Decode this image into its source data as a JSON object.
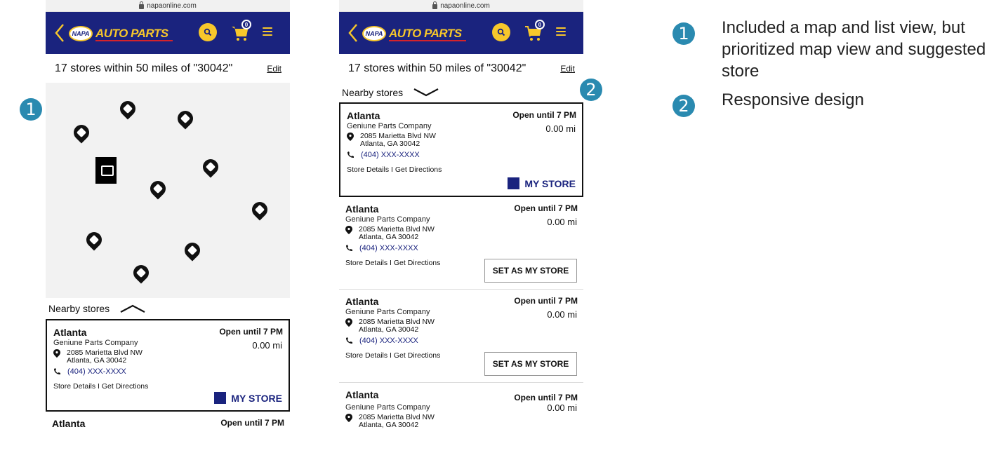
{
  "phone1": {
    "url": "napaonline.com",
    "header": {
      "logo_badge": "NAPA",
      "logo_text": "AUTO PARTS",
      "cart_count": "0"
    },
    "results_text": "17 stores within 50 miles of \"30042\"",
    "edit_label": "Edit",
    "nearby_label": "Nearby stores",
    "stores": [
      {
        "city": "Atlanta",
        "hours": "Open until 7 PM",
        "company": "Geniune Parts Company",
        "distance": "0.00 mi",
        "address1": "2085 Marietta Blvd NW",
        "address2": "Atlanta,  GA 30042",
        "phone": "(404) XXX-XXXX",
        "links": "Store Details I Get Directions",
        "action": "MY STORE"
      },
      {
        "city": "Atlanta",
        "hours": "Open until 7 PM"
      }
    ]
  },
  "phone2": {
    "url": "napaonline.com",
    "header": {
      "logo_badge": "NAPA",
      "logo_text": "AUTO PARTS",
      "cart_count": "0"
    },
    "results_text": "17 stores within 50 miles of \"30042\"",
    "edit_label": "Edit",
    "nearby_label": "Nearby stores",
    "stores": [
      {
        "city": "Atlanta",
        "hours": "Open until 7 PM",
        "company": "Geniune Parts Company",
        "distance": "0.00 mi",
        "address1": "2085 Marietta Blvd NW",
        "address2": "Atlanta,  GA 30042",
        "phone": "(404) XXX-XXXX",
        "links": "Store Details I Get Directions",
        "action": "MY STORE"
      },
      {
        "city": "Atlanta",
        "hours": "Open until 7 PM",
        "company": "Geniune Parts Company",
        "distance": "0.00 mi",
        "address1": "2085 Marietta Blvd NW",
        "address2": "Atlanta,  GA 30042",
        "phone": "(404) XXX-XXXX",
        "links": "Store Details I Get Directions",
        "action": "SET AS MY STORE"
      },
      {
        "city": "Atlanta",
        "hours": "Open until 7 PM",
        "company": "Geniune Parts Company",
        "distance": "0.00 mi",
        "address1": "2085 Marietta Blvd NW",
        "address2": "Atlanta,  GA 30042",
        "phone": "(404) XXX-XXXX",
        "links": "Store Details I Get Directions",
        "action": "SET AS MY STORE"
      },
      {
        "city": "Atlanta",
        "hours": "Open until 7 PM",
        "company": "Geniune Parts Company",
        "distance": "0.00 mi",
        "address1": "2085 Marietta Blvd NW",
        "address2": "Atlanta,  GA 30042"
      }
    ]
  },
  "markers": [
    "1",
    "2"
  ],
  "notes": [
    {
      "number": "1",
      "text": "Included a map and list view, but prioritized map view and suggested store"
    },
    {
      "number": "2",
      "text": "Responsive design"
    }
  ],
  "colors": {
    "brand_blue": "#1a237e",
    "brand_yellow": "#f7c72b",
    "marker_teal": "#2a8ab0",
    "map_bg": "#f2f2f2"
  },
  "icons": [
    "back-chevron-icon",
    "search-icon",
    "cart-icon",
    "menu-icon",
    "map-pin-icon",
    "phone-icon",
    "store-pin-icon",
    "caret-icon",
    "lock-icon"
  ]
}
